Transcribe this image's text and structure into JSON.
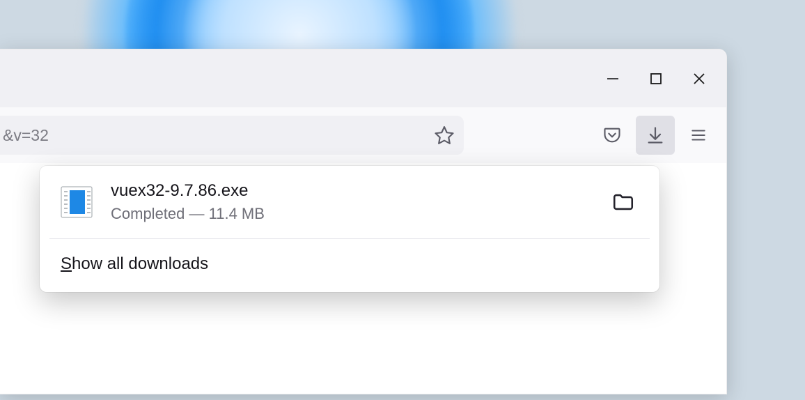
{
  "address_bar": {
    "url_fragment": "&v=32"
  },
  "downloads": {
    "items": [
      {
        "filename": "vuex32-9.7.86.exe",
        "status": "Completed — 11.4 MB"
      }
    ],
    "show_all_label_prefix": "S",
    "show_all_label_rest": "how all downloads"
  }
}
